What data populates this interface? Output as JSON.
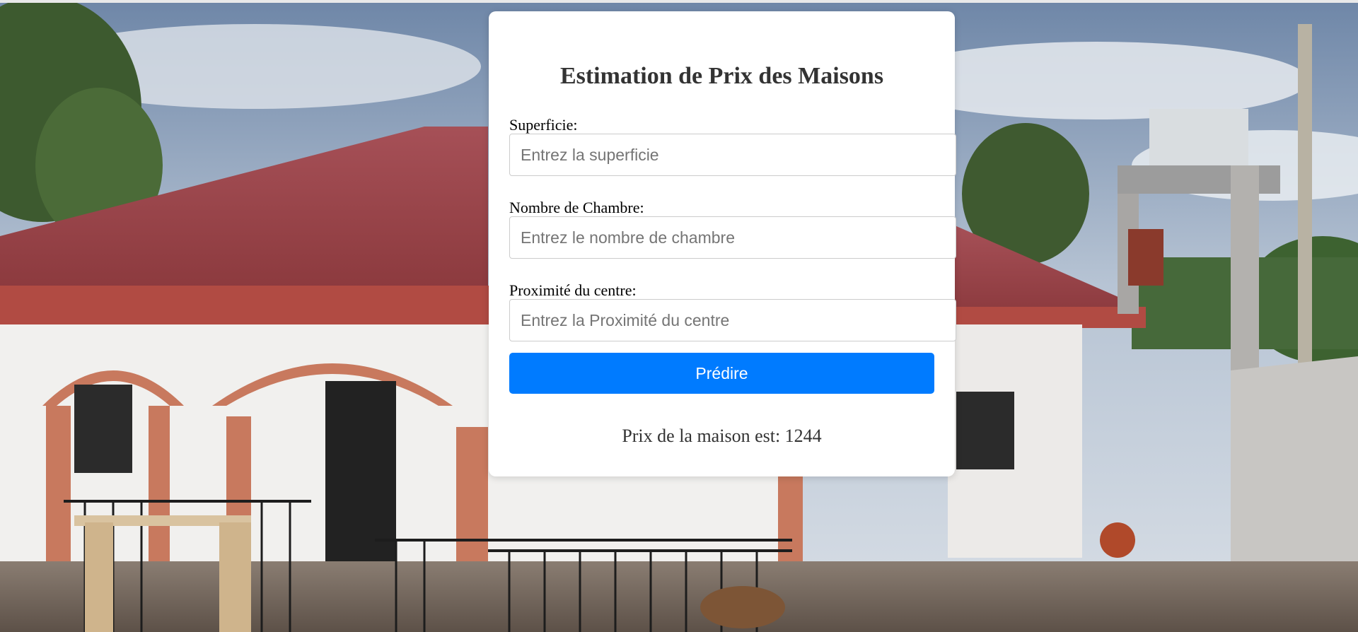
{
  "form": {
    "title": "Estimation de Prix des Maisons",
    "fields": [
      {
        "label": "Superficie:",
        "placeholder": "Entrez la superficie",
        "value": ""
      },
      {
        "label": "Nombre de Chambre:",
        "placeholder": "Entrez le nombre de chambre",
        "value": ""
      },
      {
        "label": "Proximité du centre:",
        "placeholder": "Entrez la Proximité du centre",
        "value": ""
      }
    ],
    "submit_label": "Prédire",
    "result_text": "Prix de la maison est: 1244"
  },
  "colors": {
    "accent": "#007bff",
    "card_background": "#ffffff",
    "title_text": "#333333"
  }
}
